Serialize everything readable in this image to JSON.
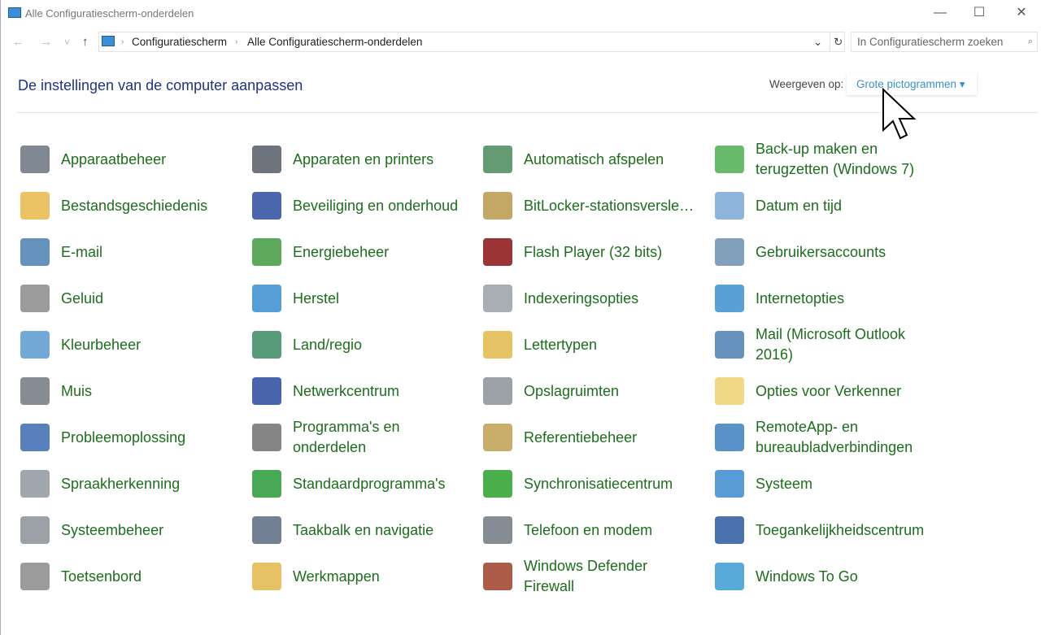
{
  "window": {
    "title": "Alle Configuratiescherm-onderdelen",
    "minimize": "—",
    "maximize": "☐",
    "close": "✕"
  },
  "nav": {
    "back": "←",
    "forward": "→",
    "recent": "˅",
    "up": "↑",
    "dropdown": "⌄",
    "refresh": "↻"
  },
  "breadcrumb": [
    "Configuratiescherm",
    "Alle Configuratiescherm-onderdelen"
  ],
  "breadcrumb_sep": "›",
  "search": {
    "placeholder": "In Configuratiescherm zoeken",
    "icon": "⌕"
  },
  "header": {
    "title": "De instellingen van de computer aanpassen",
    "view_label": "Weergeven op:",
    "view_value": "Grote pictogrammen ▾"
  },
  "items": [
    {
      "label": "Apparaatbeheer",
      "color": "#6a7380"
    },
    {
      "label": "Apparaten en printers",
      "color": "#555c66"
    },
    {
      "label": "Automatisch afspelen",
      "color": "#4a8a5a"
    },
    {
      "label": "Back-up maken en terugzetten (Windows 7)",
      "color": "#4caf50"
    },
    {
      "label": "Bestandsgeschiedenis",
      "color": "#e8b84a"
    },
    {
      "label": "Beveiliging en onderhoud",
      "color": "#2d4ba0"
    },
    {
      "label": "BitLocker-stationsversle…",
      "color": "#b89a4a"
    },
    {
      "label": "Datum en tijd",
      "color": "#7aa7d6"
    },
    {
      "label": "E-mail",
      "color": "#4a7fb0"
    },
    {
      "label": "Energiebeheer",
      "color": "#3f9a3f"
    },
    {
      "label": "Flash Player (32 bits)",
      "color": "#8a1010"
    },
    {
      "label": "Gebruikersaccounts",
      "color": "#6a8fb0"
    },
    {
      "label": "Geluid",
      "color": "#8a8a8a"
    },
    {
      "label": "Herstel",
      "color": "#3a8fd0"
    },
    {
      "label": "Indexeringsopties",
      "color": "#9aa0a8"
    },
    {
      "label": "Internetopties",
      "color": "#3a90d0"
    },
    {
      "label": "Kleurbeheer",
      "color": "#5a9ad0"
    },
    {
      "label": "Land/regio",
      "color": "#3a8a60"
    },
    {
      "label": "Lettertypen",
      "color": "#e0b84a"
    },
    {
      "label": "Mail (Microsoft Outlook 2016)",
      "color": "#4a7fb0"
    },
    {
      "label": "Muis",
      "color": "#707880"
    },
    {
      "label": "Netwerkcentrum",
      "color": "#2a4aa0"
    },
    {
      "label": "Opslagruimten",
      "color": "#8a9098"
    },
    {
      "label": "Opties voor Verkenner",
      "color": "#f0d070"
    },
    {
      "label": "Probleemoplossing",
      "color": "#3a6ab0"
    },
    {
      "label": "Programma's en onderdelen",
      "color": "#707070"
    },
    {
      "label": "Referentiebeheer",
      "color": "#c0a050"
    },
    {
      "label": "RemoteApp- en bureaubladverbindingen",
      "color": "#3a80c0"
    },
    {
      "label": "Spraakherkenning",
      "color": "#9098a0"
    },
    {
      "label": "Standaardprogramma's",
      "color": "#2a9a3a"
    },
    {
      "label": "Synchronisatiecentrum",
      "color": "#2aa02a"
    },
    {
      "label": "Systeem",
      "color": "#3a8ad0"
    },
    {
      "label": "Systeembeheer",
      "color": "#8a9098"
    },
    {
      "label": "Taakbalk en navigatie",
      "color": "#5a6a80"
    },
    {
      "label": "Telefoon en modem",
      "color": "#707880"
    },
    {
      "label": "Toegankelijkheidscentrum",
      "color": "#2a5aa0"
    },
    {
      "label": "Toetsenbord",
      "color": "#8a8a8a"
    },
    {
      "label": "Werkmappen",
      "color": "#e0b84a"
    },
    {
      "label": "Windows Defender Firewall",
      "color": "#a0402a"
    },
    {
      "label": "Windows To Go",
      "color": "#3a9ad0"
    }
  ]
}
